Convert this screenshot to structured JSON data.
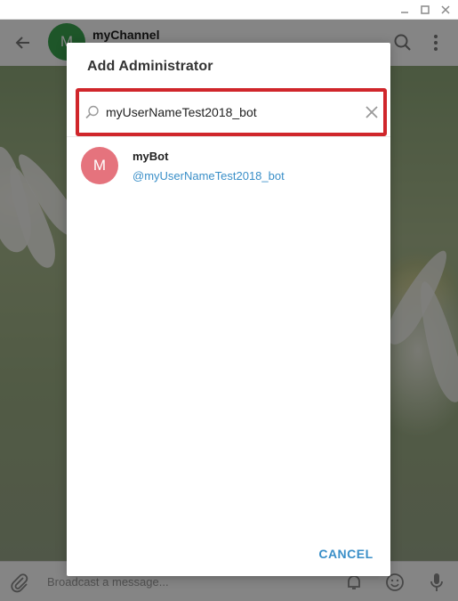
{
  "window": {
    "minimize_icon": "minimize-icon",
    "maximize_icon": "maximize-icon",
    "close_icon": "close-icon"
  },
  "chat": {
    "title": "myChannel",
    "avatar_letter": "M",
    "avatar_color": "#3aa54f"
  },
  "composer": {
    "placeholder": "Broadcast a message..."
  },
  "dialog": {
    "title": "Add Administrator",
    "search": {
      "value": "myUserNameTest2018_bot",
      "highlight_color": "#d0262b"
    },
    "results": [
      {
        "avatar_letter": "M",
        "avatar_color": "#e5737d",
        "name": "myBot",
        "username": "@myUserNameTest2018_bot"
      }
    ],
    "cancel_label": "CANCEL",
    "accent_color": "#3a8fc8"
  }
}
